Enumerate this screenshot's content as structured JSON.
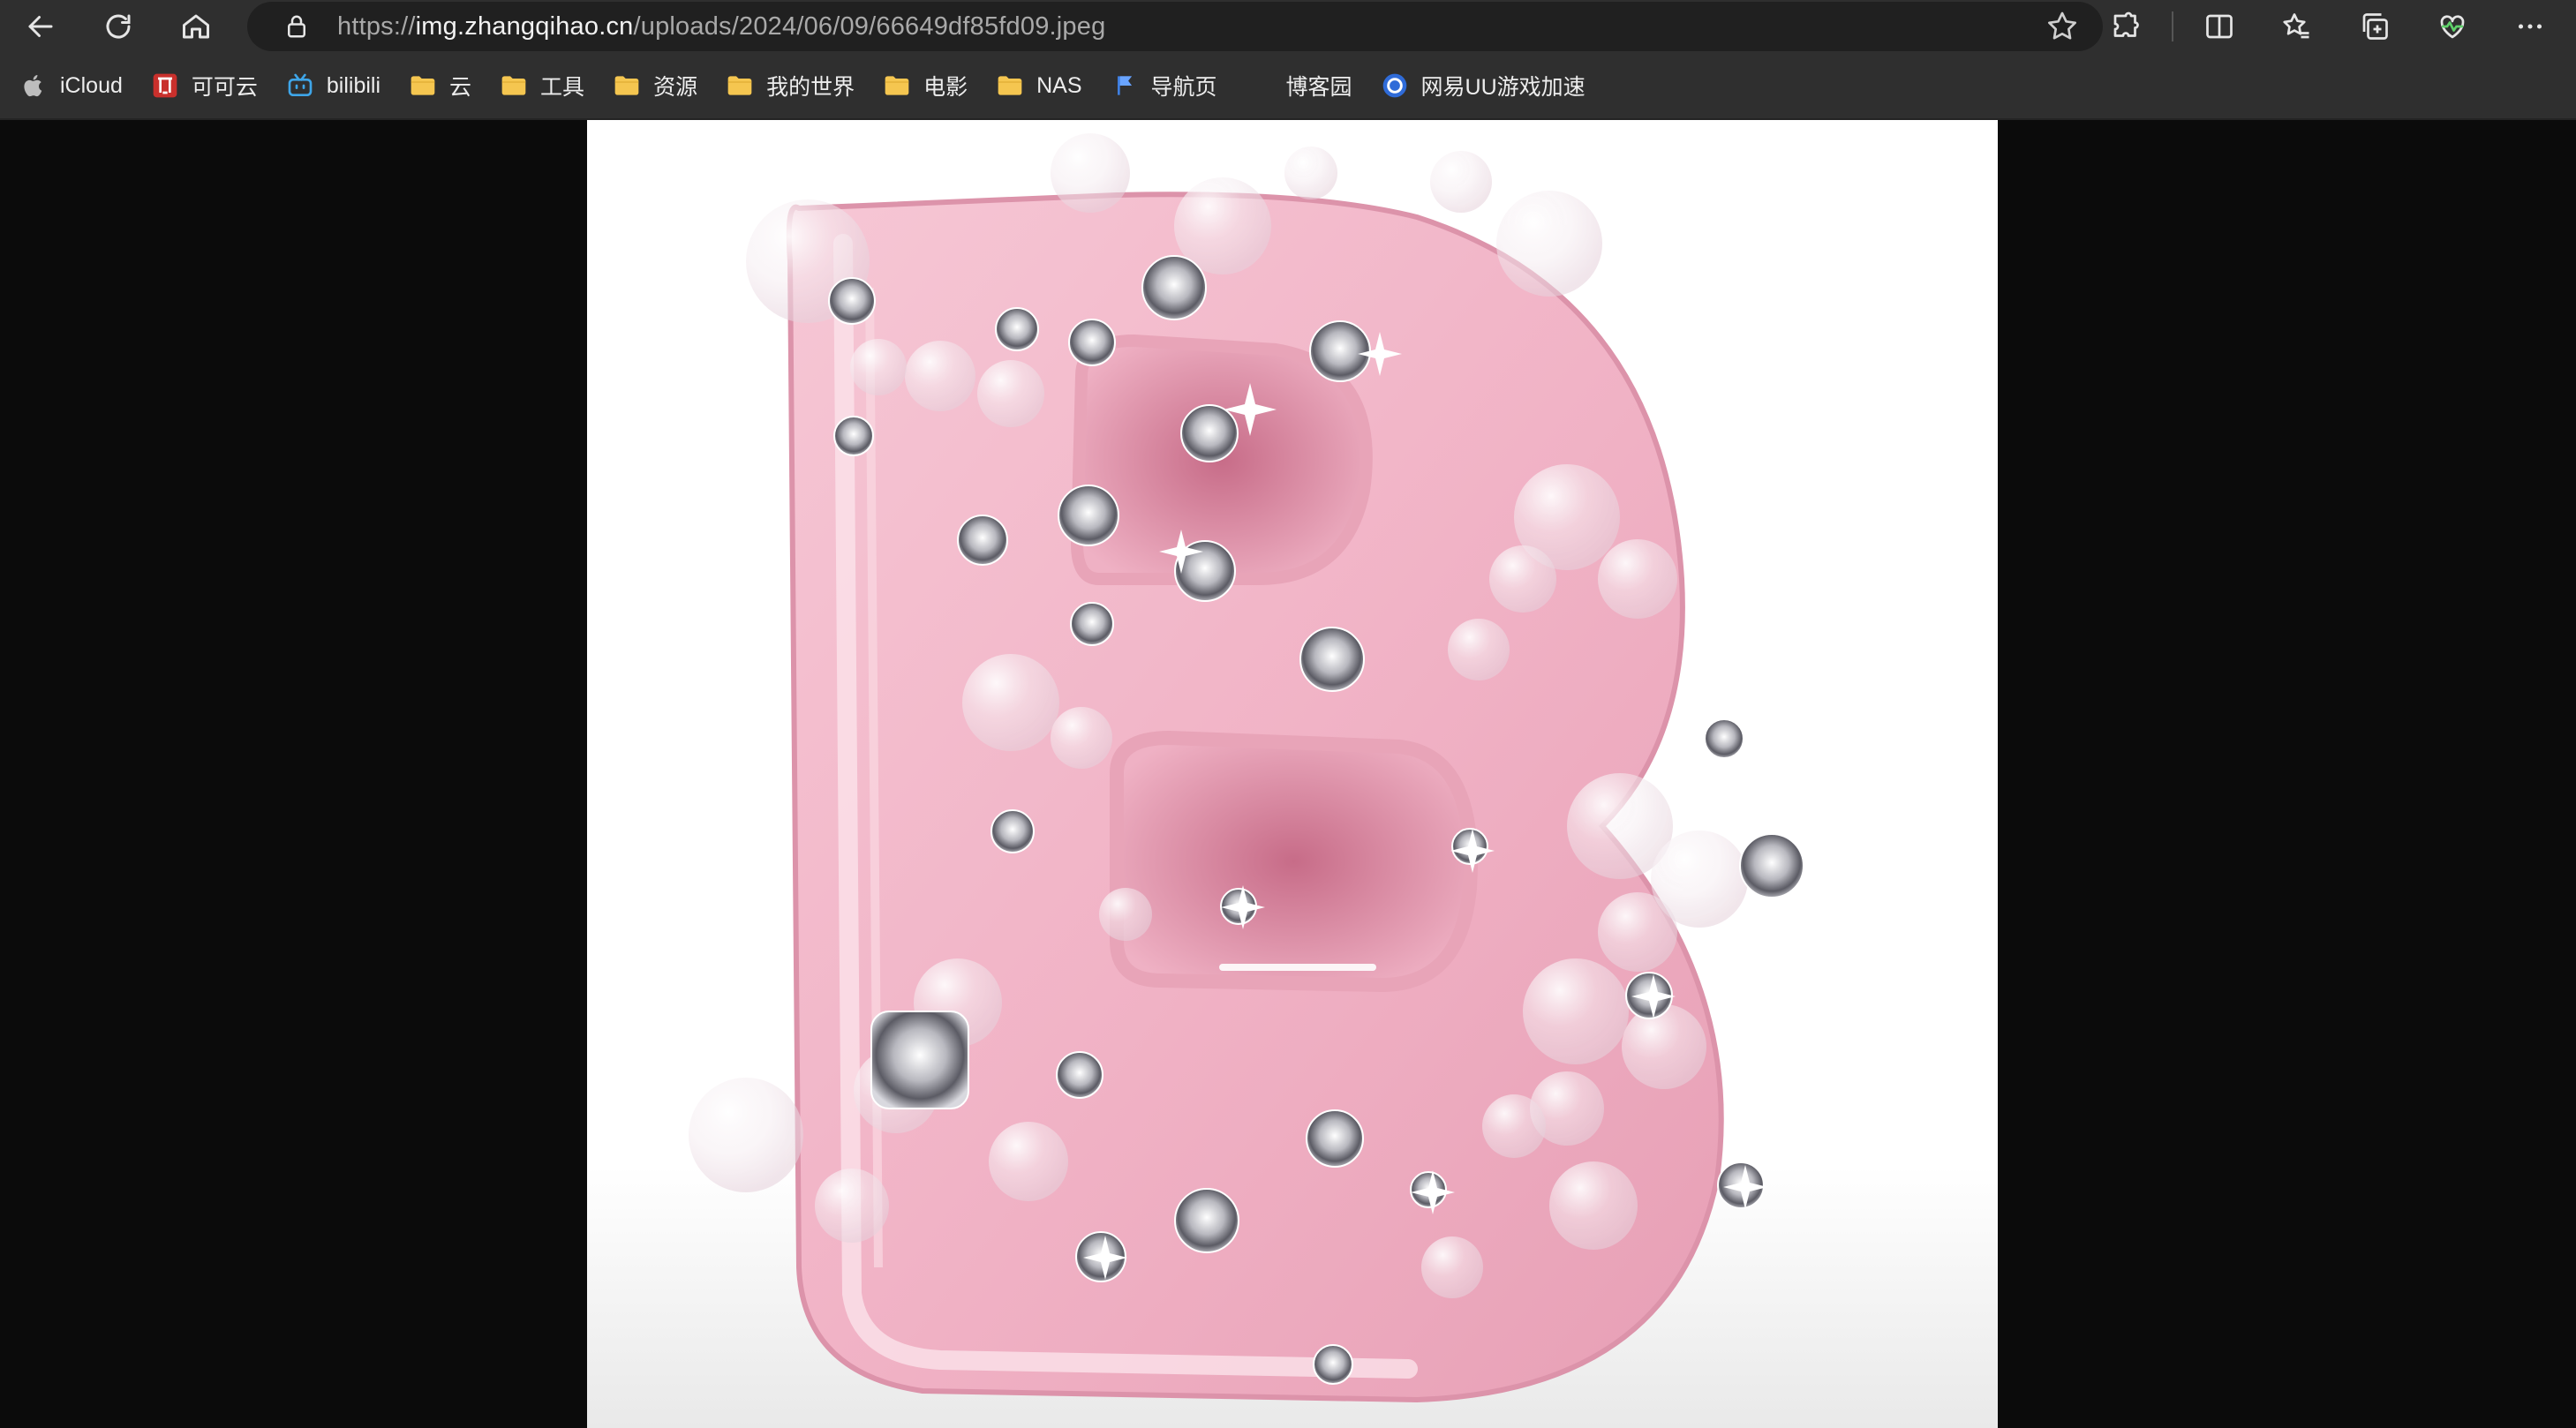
{
  "toolbar": {
    "url_scheme": "https://",
    "url_host": "img.zhangqihao.cn",
    "url_path": "/uploads/2024/06/09/66649df85fd09.jpeg",
    "icons": {
      "back": "back-arrow-icon",
      "reload": "reload-icon",
      "home": "home-icon",
      "lock": "lock-icon",
      "favorite": "star-icon",
      "extensions": "puzzle-icon",
      "split": "split-screen-icon",
      "favorites": "favorites-icon",
      "collections": "collections-icon",
      "health": "browser-essentials-icon",
      "more": "more-icon"
    }
  },
  "bookmarks": [
    {
      "label": "iCloud",
      "icon": "apple-icon"
    },
    {
      "label": "可可云",
      "icon": "kekeyun-icon"
    },
    {
      "label": "bilibili",
      "icon": "bilibili-icon"
    },
    {
      "label": "云",
      "icon": "folder-icon"
    },
    {
      "label": "工具",
      "icon": "folder-icon"
    },
    {
      "label": "资源",
      "icon": "folder-icon"
    },
    {
      "label": "我的世界",
      "icon": "folder-icon"
    },
    {
      "label": "电影",
      "icon": "folder-icon"
    },
    {
      "label": "NAS",
      "icon": "folder-icon"
    },
    {
      "label": "导航页",
      "icon": "flag-icon"
    },
    {
      "label": "博客园",
      "icon": "blank-icon"
    },
    {
      "label": "网易UU游戏加速",
      "icon": "uu-icon"
    }
  ],
  "colors": {
    "toolbar_bg": "#2f2f2f",
    "address_bg": "#202020",
    "folder": "#f5c650",
    "letter_pink": "#f2b7c8",
    "letter_shadow": "#c8788f"
  }
}
